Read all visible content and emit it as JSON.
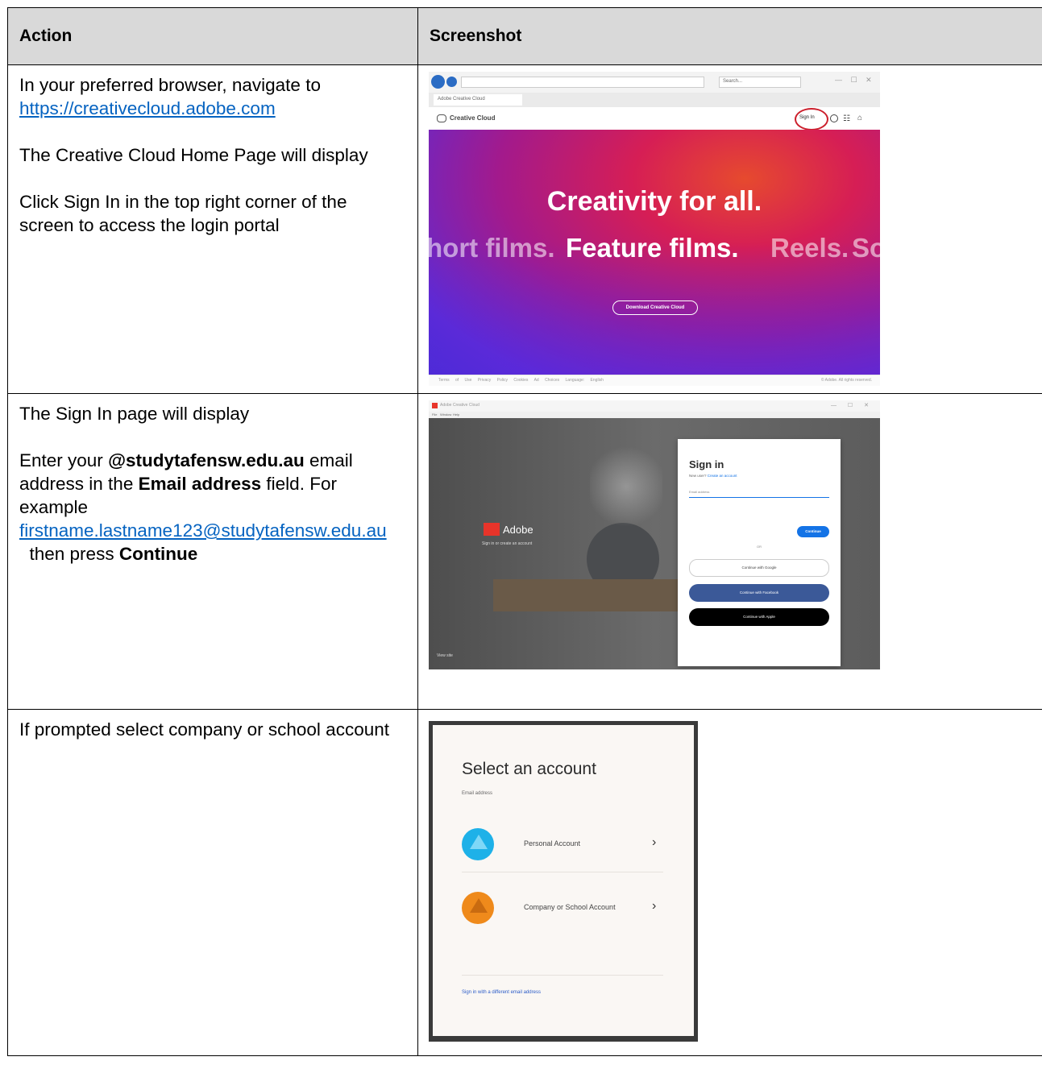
{
  "table": {
    "headers": {
      "action": "Action",
      "screenshot": "Screenshot"
    },
    "rows": [
      {
        "action": {
          "line1": "In your preferred browser, navigate to",
          "link": "https://creativecloud.adobe.com",
          "para2": "The Creative Cloud Home Page will display",
          "para3": "Click Sign In in the top right corner of the screen to access the login portal"
        }
      },
      {
        "action": {
          "para1": "The Sign In page will display",
          "enter_prefix": "Enter your ",
          "enter_bold_domain": "@studytafensw.edu.au",
          "enter_mid": " email address in the ",
          "enter_bold_field": "Email address",
          "enter_suffix": " field. For example",
          "example_link": "firstname.lastname123@studytafensw.edu.au",
          "then_text": "  then press ",
          "continue_bold": "Continue"
        }
      },
      {
        "action": {
          "para1": "If prompted select company or school account"
        }
      }
    ]
  },
  "shot1": {
    "search_placeholder": "Search...",
    "tab_title": "Adobe Creative Cloud",
    "app_name": "Creative Cloud",
    "signin_label": "Sign In",
    "hero_title": "Creativity for all.",
    "hero_ticker_left": "hort films.",
    "hero_ticker_main": "Feature films.",
    "hero_ticker_right1": "Reels.",
    "hero_ticker_right2": "So",
    "download_button": "Download Creative Cloud",
    "footer_links": [
      "Terms of Use",
      "Privacy Policy",
      "Cookies",
      "Ad Choices",
      "Language: English"
    ],
    "footer_copyright": "© Adobe. All rights reserved.",
    "highlight_color": "#cc1f2c"
  },
  "shot2": {
    "window_title": "Adobe Creative Cloud",
    "menu_items": [
      "File",
      "Window",
      "Help"
    ],
    "brand": "Adobe",
    "brand_tagline": "Sign in or create an account",
    "signin_title": "Sign in",
    "new_user_prefix": "New user?",
    "create_account": "Create an account",
    "email_label": "Email address",
    "continue_button": "Continue",
    "or_text": "OR",
    "google_button": "Continue with Google",
    "facebook_button": "Continue with Facebook",
    "apple_button": "Continue with Apple",
    "view_site": "View site",
    "facebook_color": "#3b5998",
    "continue_color": "#1473e6"
  },
  "shot3": {
    "title": "Select an account",
    "email_label": "Email address",
    "personal_account": "Personal Account",
    "company_account": "Company or School Account",
    "different_email": "Sign in with a different email address"
  }
}
